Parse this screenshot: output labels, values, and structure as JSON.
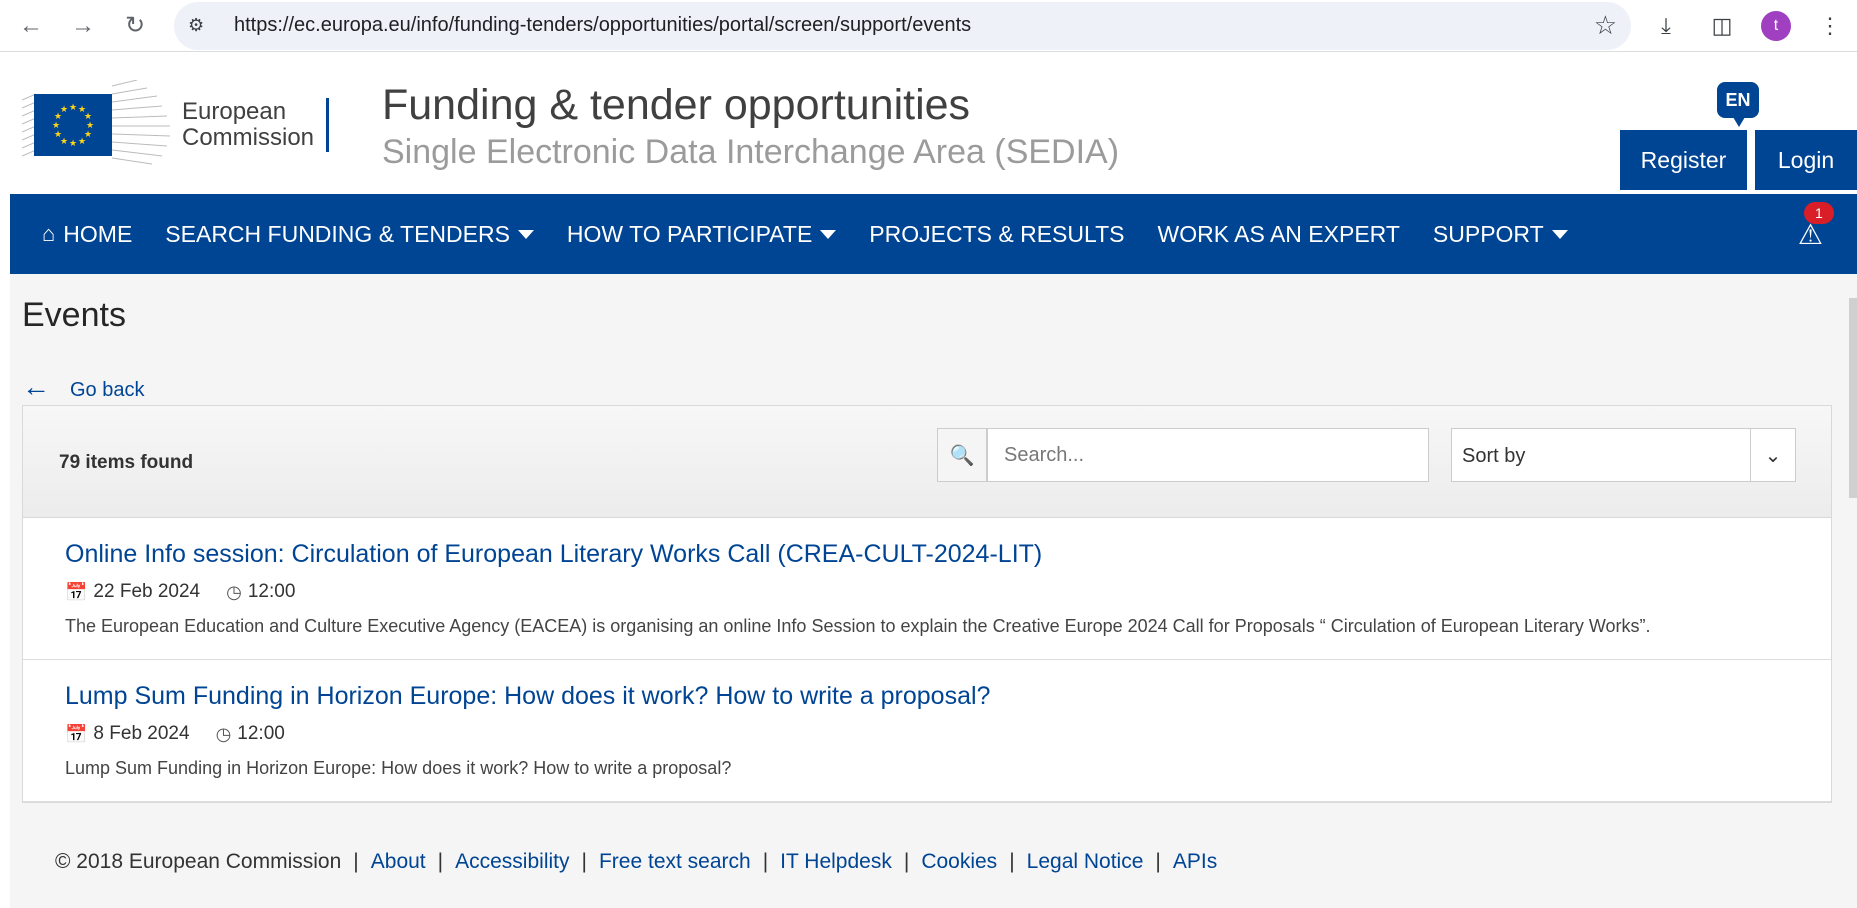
{
  "browser": {
    "url": "https://ec.europa.eu/info/funding-tenders/opportunities/portal/screen/support/events",
    "avatar_letter": "t",
    "icons": [
      "back-icon",
      "forward-icon",
      "reload-icon",
      "site-settings-icon",
      "star-icon",
      "download-icon",
      "sidebar-icon",
      "menu-icon"
    ]
  },
  "header": {
    "logo_line1": "European",
    "logo_line2": "Commission",
    "title": "Funding & tender opportunities",
    "subtitle": "Single Electronic Data Interchange Area (SEDIA)",
    "lang": "EN",
    "register": "Register",
    "login": "Login"
  },
  "nav": {
    "items": [
      {
        "label": "HOME",
        "icon": "home-icon",
        "dropdown": false
      },
      {
        "label": "SEARCH FUNDING & TENDERS",
        "dropdown": true
      },
      {
        "label": "HOW TO PARTICIPATE",
        "dropdown": true
      },
      {
        "label": "PROJECTS & RESULTS",
        "dropdown": false
      },
      {
        "label": "WORK AS AN EXPERT",
        "dropdown": false
      },
      {
        "label": "SUPPORT",
        "dropdown": true
      }
    ],
    "alert_count": "1"
  },
  "main": {
    "title": "Events",
    "go_back": "Go back",
    "count": "79 items found",
    "search_placeholder": "Search...",
    "sort_label": "Sort by",
    "events": [
      {
        "title": "Online Info session: Circulation of European Literary Works Call (CREA-CULT-2024-LIT)",
        "date": "22 Feb 2024",
        "time": "12:00",
        "description": "The European Education and Culture Executive Agency (EACEA) is organising an online Info Session to explain the Creative Europe 2024 Call for Proposals “ Circulation of European Literary Works”."
      },
      {
        "title": "Lump Sum Funding in Horizon Europe: How does it work? How to write a proposal?",
        "date": "8 Feb 2024",
        "time": "12:00",
        "description": "Lump Sum Funding in Horizon Europe: How does it work? How to write a proposal?"
      }
    ]
  },
  "footer": {
    "copyright": "© 2018 European Commission",
    "links": [
      "About",
      "Accessibility",
      "Free text search",
      "IT Helpdesk",
      "Cookies",
      "Legal Notice",
      "APIs"
    ]
  },
  "colors": {
    "brand": "#004494",
    "alert": "#da1e28",
    "avatar": "#a03fc0"
  }
}
